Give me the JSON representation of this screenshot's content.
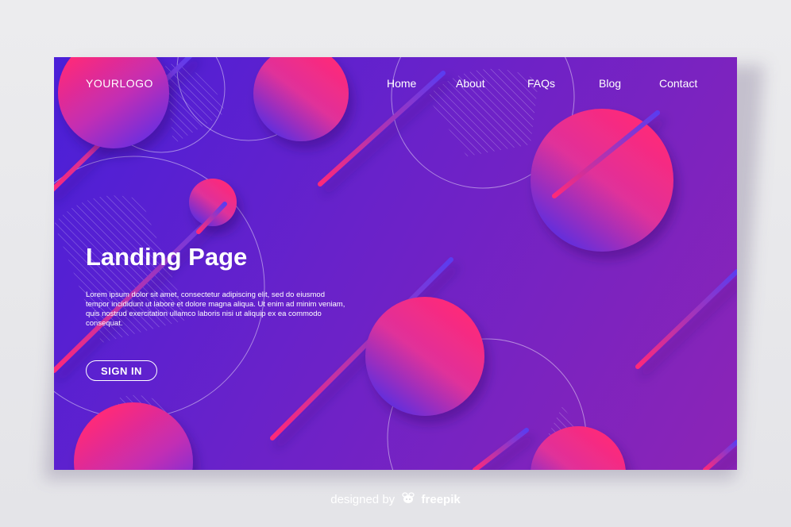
{
  "header": {
    "logo": "YOURLOGO",
    "nav": [
      {
        "label": "Home"
      },
      {
        "label": "About"
      },
      {
        "label": "FAQs"
      },
      {
        "label": "Blog"
      },
      {
        "label": "Contact"
      }
    ]
  },
  "hero": {
    "title": "Landing Page",
    "body": "Lorem ipsum dolor sit amet, consectetur adipiscing elit, sed do eiusmod tempor incididunt ut labore et dolore magna aliqua. Ut enim ad minim veniam, quis nostrud exercitation ullamco laboris nisi ut aliquip ex ea commodo consequat.",
    "cta": "SIGN IN"
  },
  "credit": {
    "prefix": "designed by",
    "brand": "freepik",
    "icon": "freepik-bee-icon"
  },
  "colors": {
    "background": "#e8e8ec",
    "gradient_start": "#4a1fd8",
    "gradient_end": "#8c24b6",
    "accent_pink": "#ff2d7a",
    "text": "#ffffff"
  }
}
